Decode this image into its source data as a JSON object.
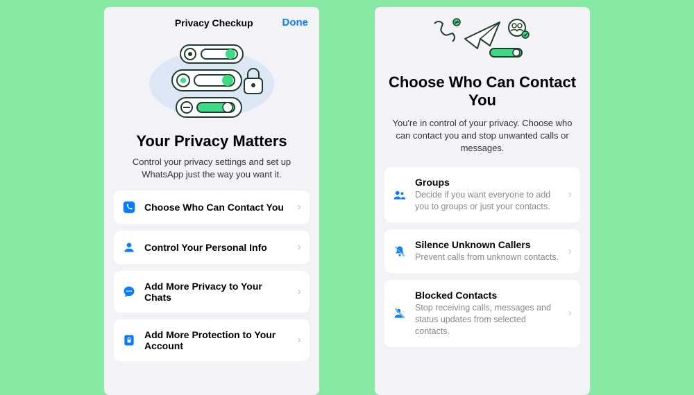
{
  "left": {
    "nav_title": "Privacy Checkup",
    "nav_done": "Done",
    "hero_title": "Your Privacy Matters",
    "hero_sub": "Control your privacy settings and set up WhatsApp just the way you want it.",
    "items": [
      {
        "title": "Choose Who Can Contact You"
      },
      {
        "title": "Control Your Personal Info"
      },
      {
        "title": "Add More Privacy to Your Chats"
      },
      {
        "title": "Add More Protection to Your Account"
      }
    ]
  },
  "right": {
    "hero_title": "Choose Who Can Contact You",
    "hero_sub": "You're in control of your privacy. Choose who can contact you and stop unwanted calls or messages.",
    "items": [
      {
        "title": "Groups",
        "desc": "Decide if you want everyone to add you to groups or just your contacts."
      },
      {
        "title": "Silence Unknown Callers",
        "desc": "Prevent calls from unknown contacts."
      },
      {
        "title": "Blocked Contacts",
        "desc": "Stop receiving calls, messages and status updates from selected contacts."
      }
    ]
  }
}
